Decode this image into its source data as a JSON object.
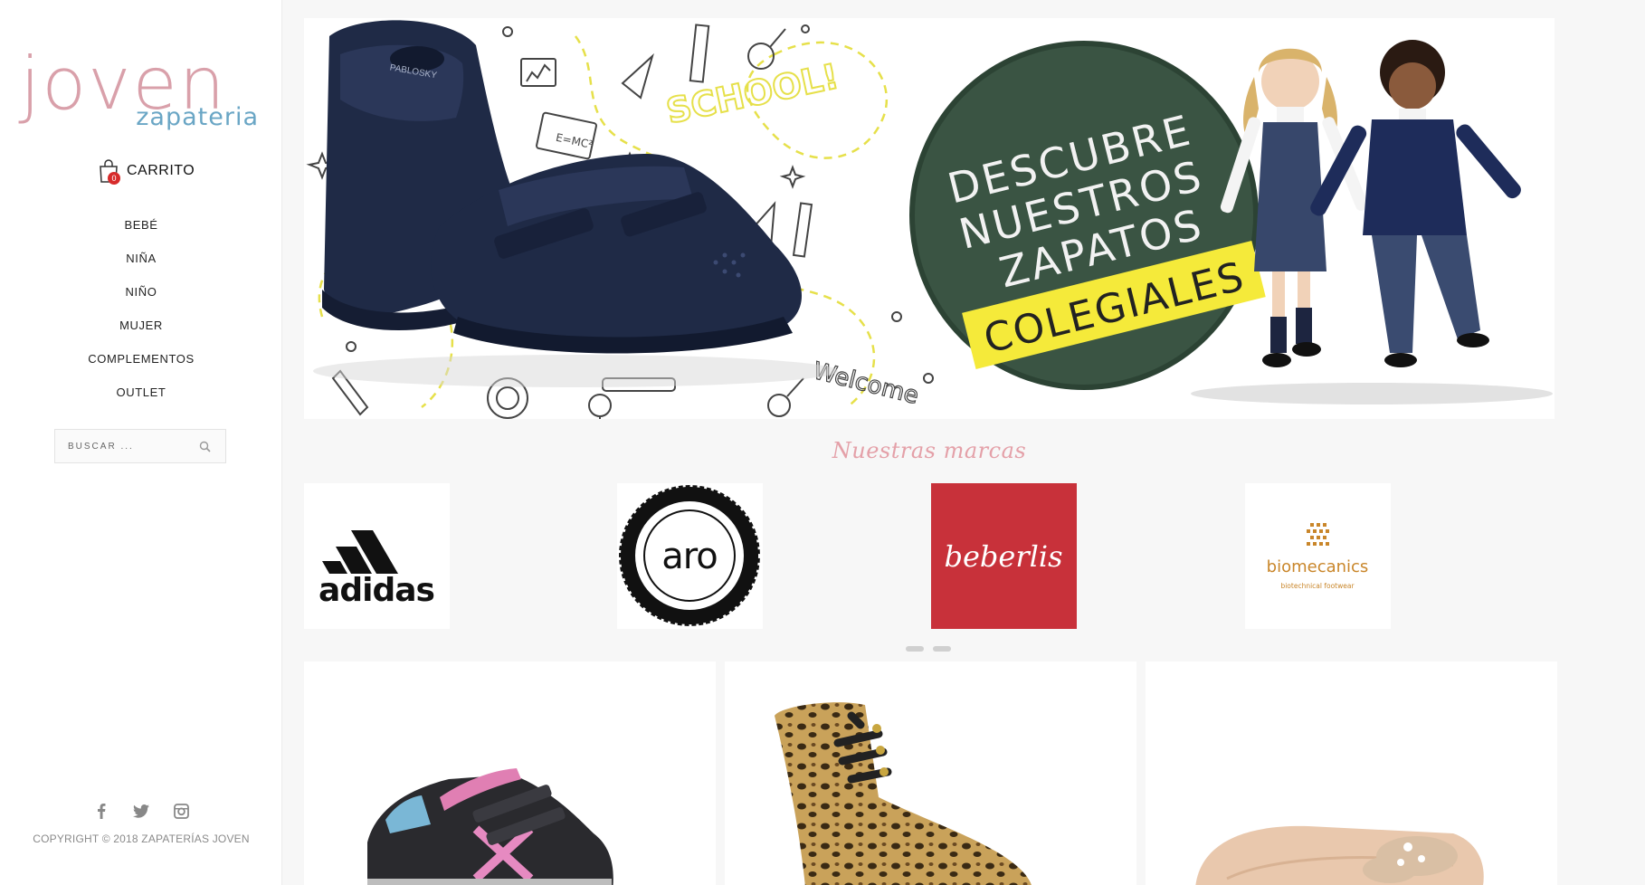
{
  "logo": {
    "main": "joven",
    "sub": "zapateria"
  },
  "cart": {
    "label": "CARRITO",
    "count": "0"
  },
  "nav": {
    "items": [
      {
        "label": "BEBÉ"
      },
      {
        "label": "NIÑA"
      },
      {
        "label": "NIÑO"
      },
      {
        "label": "MUJER"
      },
      {
        "label": "COMPLEMENTOS"
      },
      {
        "label": "OUTLET"
      }
    ]
  },
  "search": {
    "placeholder": "BUSCAR ..."
  },
  "social": {
    "icons": [
      "facebook-icon",
      "twitter-icon",
      "instagram-icon"
    ]
  },
  "footer": {
    "copyright": "COPYRIGHT © 2018 ZAPATERÍAS JOVEN"
  },
  "banner": {
    "headline_lines": [
      "DESCUBRE",
      "NUESTROS",
      "ZAPATOS"
    ],
    "highlight": "COLEGIALES",
    "doodle_school": "SCHOOL!",
    "doodle_welcome": "Welcome",
    "doodle_formula": "E=MC²",
    "shoe_brand": "PABLOSKY"
  },
  "brands": {
    "title": "Nuestras marcas",
    "items": [
      {
        "name": "adidas"
      },
      {
        "name": "aro"
      },
      {
        "name": "beberlis"
      },
      {
        "name": "biomecanics",
        "tagline": "biotechnical footwear"
      }
    ]
  },
  "products": [
    {
      "name": "sneaker-pink-black"
    },
    {
      "name": "leopard-boot"
    },
    {
      "name": "beige-ballerina"
    }
  ],
  "colors": {
    "accent_pink": "#e4a0a8",
    "logo_pink": "#d9a0aa",
    "logo_blue": "#6aa6c5",
    "beberlis_red": "#c8313a",
    "badge_red": "#d72b2b"
  }
}
